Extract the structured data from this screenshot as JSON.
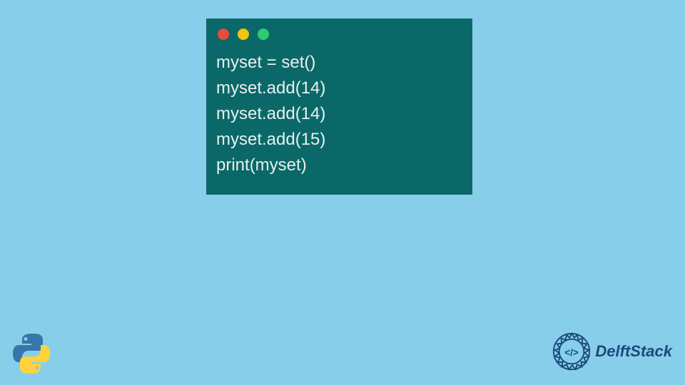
{
  "code": {
    "lines": [
      "myset = set()",
      "myset.add(14)",
      "myset.add(14)",
      "myset.add(15)",
      "print(myset)"
    ]
  },
  "branding": {
    "delft_text": "DelftStack"
  },
  "colors": {
    "background": "#87ceeb",
    "window": "#0b6868",
    "dot_red": "#e74c3c",
    "dot_yellow": "#f1c40f",
    "dot_green": "#2ecc71"
  }
}
